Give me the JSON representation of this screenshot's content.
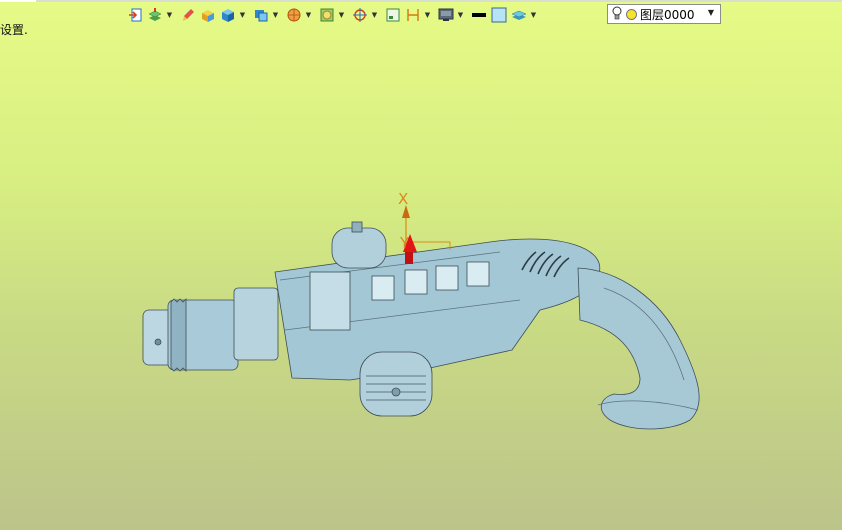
{
  "hint_text": "设置.",
  "layer": {
    "name": "图层0000"
  },
  "axis": {
    "x_label": "X",
    "y_label": "Y"
  },
  "colors": {
    "background_top": "#e6fa86",
    "background_bottom": "#bcc48a",
    "model": "#a7c9d6",
    "axis": "#d98a1a",
    "triad": "#e01515"
  },
  "toolbar": {
    "buttons": [
      "import-icon",
      "layers-icon",
      "brush-icon",
      "box-icon",
      "solid-icon",
      "display-icon",
      "sphere-icon",
      "render-icon",
      "snap-icon",
      "frame-icon",
      "dimension-icon",
      "monitor-icon",
      "black-color-icon",
      "light-blue-color-icon",
      "layer-stack-icon"
    ]
  }
}
